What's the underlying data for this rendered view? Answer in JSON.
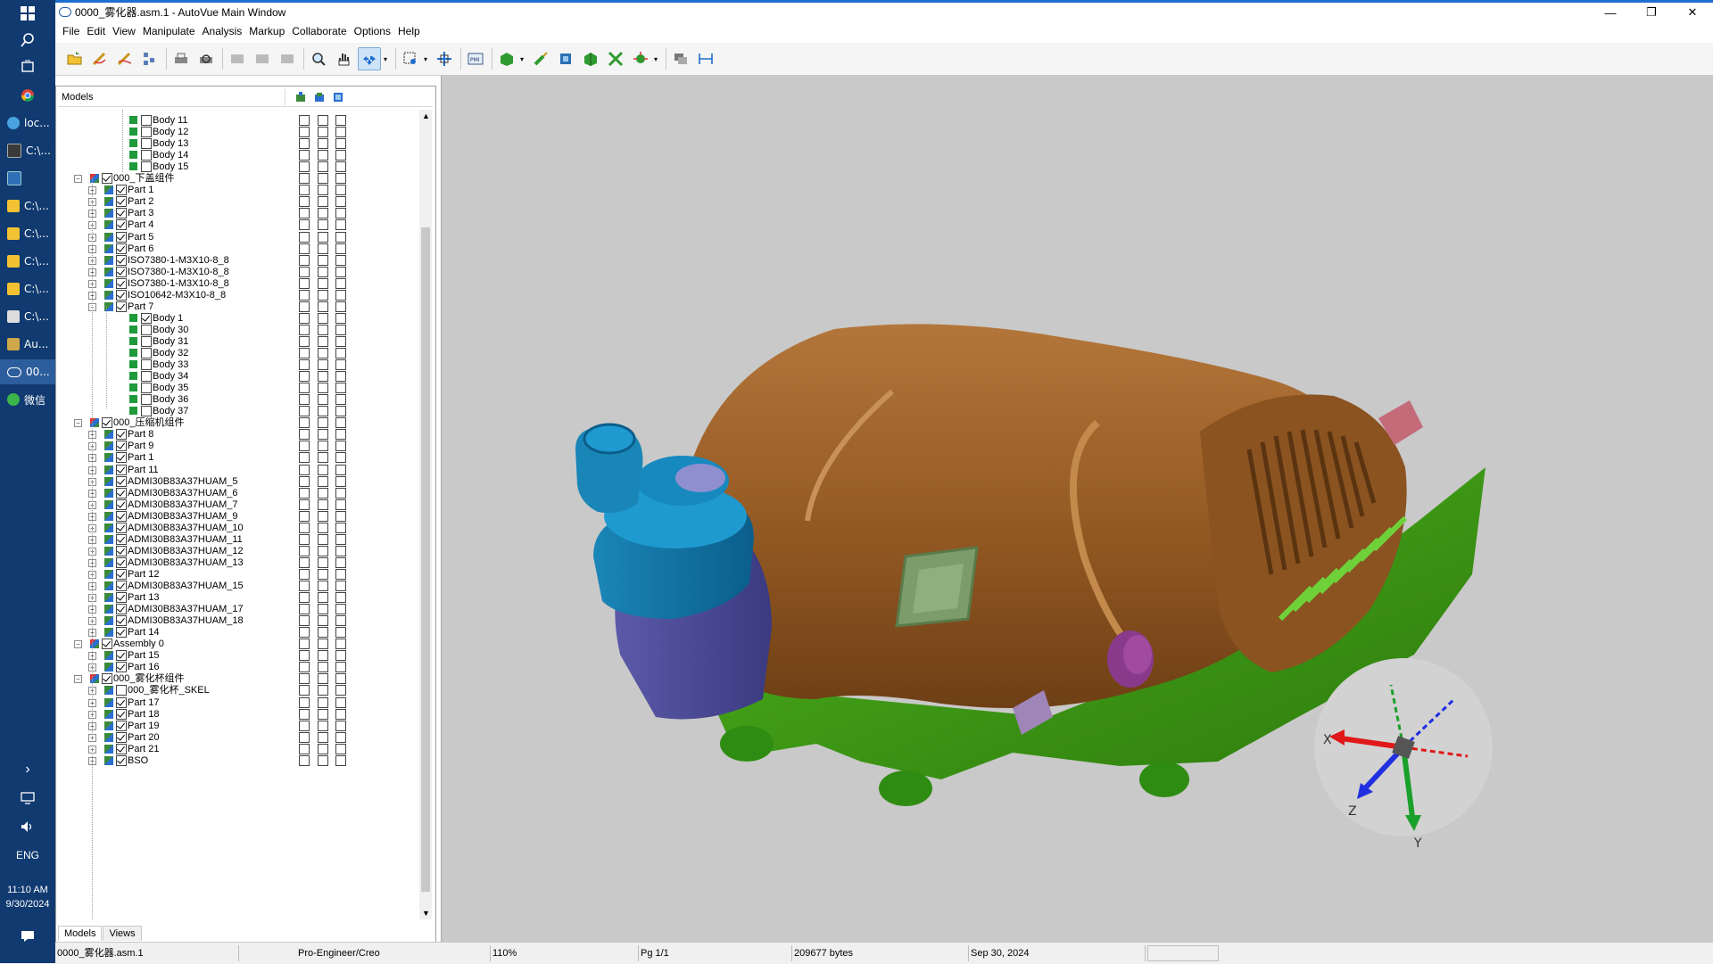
{
  "taskbar": {
    "items": [
      {
        "label": "loc...",
        "color": "#4aa3df"
      },
      {
        "label": "C:\\...",
        "color": "#3a3a3a"
      },
      {
        "label": "",
        "color": "#2e6fb8"
      },
      {
        "label": "C:\\...",
        "color": "#f2c233"
      },
      {
        "label": "C:\\...",
        "color": "#f2c233"
      },
      {
        "label": "C:\\...",
        "color": "#f2c233"
      },
      {
        "label": "C:\\...",
        "color": "#f2c233"
      },
      {
        "label": "C:\\...",
        "color": "#dcdcdc"
      },
      {
        "label": "Au...",
        "color": "#cfa64a"
      },
      {
        "label": "00...",
        "color": "#2a5ea8"
      },
      {
        "label": "微信",
        "color": "#3bb54a"
      }
    ],
    "lang": "ENG",
    "time": "11:10 AM",
    "date": "9/30/2024"
  },
  "window": {
    "title": "0000_雾化器.asm.1 - AutoVue Main Window",
    "minimize": "—",
    "restore": "❐",
    "close": "✕"
  },
  "menu": [
    "File",
    "Edit",
    "View",
    "Manipulate",
    "Analysis",
    "Markup",
    "Collaborate",
    "Options",
    "Help"
  ],
  "panel": {
    "header": "Models",
    "tabs": [
      "Models",
      "Views"
    ]
  },
  "tree": [
    {
      "level": 3,
      "type": "body",
      "label": "Body 11",
      "checked": false,
      "expander": ""
    },
    {
      "level": 3,
      "type": "body",
      "label": "Body 12",
      "checked": false,
      "expander": ""
    },
    {
      "level": 3,
      "type": "body",
      "label": "Body 13",
      "checked": false,
      "expander": ""
    },
    {
      "level": 3,
      "type": "body",
      "label": "Body 14",
      "checked": false,
      "expander": ""
    },
    {
      "level": 3,
      "type": "body",
      "label": "Body 15",
      "checked": false,
      "expander": ""
    },
    {
      "level": 1,
      "type": "assembly",
      "label": "000_下盖组件",
      "checked": true,
      "expander": "−"
    },
    {
      "level": 2,
      "type": "part",
      "label": "Part 1",
      "checked": true,
      "expander": "+"
    },
    {
      "level": 2,
      "type": "part",
      "label": "Part 2",
      "checked": true,
      "expander": "+"
    },
    {
      "level": 2,
      "type": "part",
      "label": "Part 3",
      "checked": true,
      "expander": "+"
    },
    {
      "level": 2,
      "type": "part",
      "label": "Part 4",
      "checked": true,
      "expander": "+"
    },
    {
      "level": 2,
      "type": "part",
      "label": "Part 5",
      "checked": true,
      "expander": "+"
    },
    {
      "level": 2,
      "type": "part",
      "label": "Part 6",
      "checked": true,
      "expander": "+"
    },
    {
      "level": 2,
      "type": "part",
      "label": "ISO7380-1-M3X10-8_8",
      "checked": true,
      "expander": "+"
    },
    {
      "level": 2,
      "type": "part",
      "label": "ISO7380-1-M3X10-8_8",
      "checked": true,
      "expander": "+"
    },
    {
      "level": 2,
      "type": "part",
      "label": "ISO7380-1-M3X10-8_8",
      "checked": true,
      "expander": "+"
    },
    {
      "level": 2,
      "type": "part",
      "label": "ISO10642-M3X10-8_8",
      "checked": true,
      "expander": "+"
    },
    {
      "level": 2,
      "type": "part",
      "label": "Part 7",
      "checked": true,
      "expander": "−"
    },
    {
      "level": 3,
      "type": "body",
      "label": "Body 1",
      "checked": true,
      "expander": ""
    },
    {
      "level": 3,
      "type": "body",
      "label": "Body 30",
      "checked": false,
      "expander": ""
    },
    {
      "level": 3,
      "type": "body",
      "label": "Body 31",
      "checked": false,
      "expander": ""
    },
    {
      "level": 3,
      "type": "body",
      "label": "Body 32",
      "checked": false,
      "expander": ""
    },
    {
      "level": 3,
      "type": "body",
      "label": "Body 33",
      "checked": false,
      "expander": ""
    },
    {
      "level": 3,
      "type": "body",
      "label": "Body 34",
      "checked": false,
      "expander": ""
    },
    {
      "level": 3,
      "type": "body",
      "label": "Body 35",
      "checked": false,
      "expander": ""
    },
    {
      "level": 3,
      "type": "body",
      "label": "Body 36",
      "checked": false,
      "expander": ""
    },
    {
      "level": 3,
      "type": "body",
      "label": "Body 37",
      "checked": false,
      "expander": ""
    },
    {
      "level": 1,
      "type": "assembly",
      "label": "000_压缩机组件",
      "checked": true,
      "expander": "−"
    },
    {
      "level": 2,
      "type": "part",
      "label": "Part 8",
      "checked": true,
      "expander": "+"
    },
    {
      "level": 2,
      "type": "part",
      "label": "Part 9",
      "checked": true,
      "expander": "+"
    },
    {
      "level": 2,
      "type": "part",
      "label": "Part 1",
      "checked": true,
      "expander": "+"
    },
    {
      "level": 2,
      "type": "part",
      "label": "Part 11",
      "checked": true,
      "expander": "+"
    },
    {
      "level": 2,
      "type": "part",
      "label": "ADMI30B83A37HUAM_5",
      "checked": true,
      "expander": "+"
    },
    {
      "level": 2,
      "type": "part",
      "label": "ADMI30B83A37HUAM_6",
      "checked": true,
      "expander": "+"
    },
    {
      "level": 2,
      "type": "part",
      "label": "ADMI30B83A37HUAM_7",
      "checked": true,
      "expander": "+"
    },
    {
      "level": 2,
      "type": "part",
      "label": "ADMI30B83A37HUAM_9",
      "checked": true,
      "expander": "+"
    },
    {
      "level": 2,
      "type": "part",
      "label": "ADMI30B83A37HUAM_10",
      "checked": true,
      "expander": "+"
    },
    {
      "level": 2,
      "type": "part",
      "label": "ADMI30B83A37HUAM_11",
      "checked": true,
      "expander": "+"
    },
    {
      "level": 2,
      "type": "part",
      "label": "ADMI30B83A37HUAM_12",
      "checked": true,
      "expander": "+"
    },
    {
      "level": 2,
      "type": "part",
      "label": "ADMI30B83A37HUAM_13",
      "checked": true,
      "expander": "+"
    },
    {
      "level": 2,
      "type": "part",
      "label": "Part 12",
      "checked": true,
      "expander": "+"
    },
    {
      "level": 2,
      "type": "part",
      "label": "ADMI30B83A37HUAM_15",
      "checked": true,
      "expander": "+"
    },
    {
      "level": 2,
      "type": "part",
      "label": "Part 13",
      "checked": true,
      "expander": "+"
    },
    {
      "level": 2,
      "type": "part",
      "label": "ADMI30B83A37HUAM_17",
      "checked": true,
      "expander": "+"
    },
    {
      "level": 2,
      "type": "part",
      "label": "ADMI30B83A37HUAM_18",
      "checked": true,
      "expander": "+"
    },
    {
      "level": 2,
      "type": "part",
      "label": "Part 14",
      "checked": true,
      "expander": "+"
    },
    {
      "level": 1,
      "type": "assembly",
      "label": "Assembly 0",
      "checked": true,
      "expander": "−"
    },
    {
      "level": 2,
      "type": "part",
      "label": "Part 15",
      "checked": true,
      "expander": "+"
    },
    {
      "level": 2,
      "type": "part",
      "label": "Part 16",
      "checked": true,
      "expander": "+"
    },
    {
      "level": 1,
      "type": "assembly",
      "label": "000_雾化杯组件",
      "checked": true,
      "expander": "−"
    },
    {
      "level": 2,
      "type": "part",
      "label": "000_雾化杯_SKEL",
      "checked": false,
      "expander": "+"
    },
    {
      "level": 2,
      "type": "part",
      "label": "Part 17",
      "checked": true,
      "expander": "+"
    },
    {
      "level": 2,
      "type": "part",
      "label": "Part 18",
      "checked": true,
      "expander": "+"
    },
    {
      "level": 2,
      "type": "part",
      "label": "Part 19",
      "checked": true,
      "expander": "+"
    },
    {
      "level": 2,
      "type": "part",
      "label": "Part 20",
      "checked": true,
      "expander": "+"
    },
    {
      "level": 2,
      "type": "part",
      "label": "Part 21",
      "checked": true,
      "expander": "+"
    },
    {
      "level": 2,
      "type": "part",
      "label": "BSO",
      "checked": true,
      "expander": "+"
    }
  ],
  "viewport": {
    "axes": {
      "x": "X",
      "y": "Y",
      "z": "Z"
    }
  },
  "status": {
    "file": "0000_雾化器.asm.1",
    "format": "Pro-Engineer/Creo",
    "zoom": "110%",
    "page": "Pg 1/1",
    "size": "209677 bytes",
    "date": "Sep 30, 2024"
  }
}
